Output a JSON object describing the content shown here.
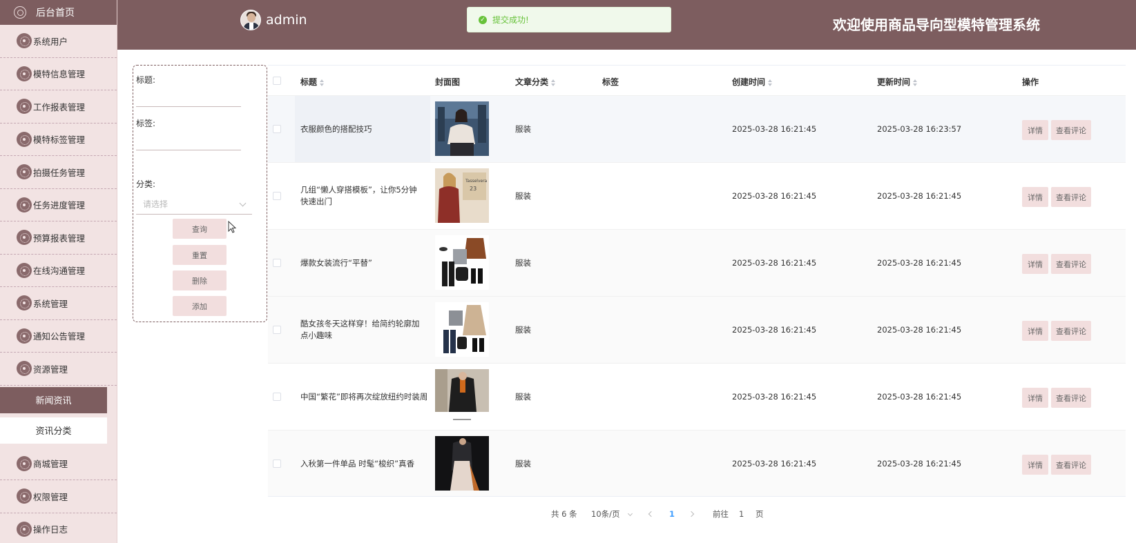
{
  "sidebar": {
    "home_label": "后台首页",
    "items": [
      {
        "label": "系统用户"
      },
      {
        "label": "模特信息管理"
      },
      {
        "label": "工作报表管理"
      },
      {
        "label": "模特标签管理"
      },
      {
        "label": "拍摄任务管理"
      },
      {
        "label": "任务进度管理"
      },
      {
        "label": "预算报表管理"
      },
      {
        "label": "在线沟通管理"
      },
      {
        "label": "系统管理"
      },
      {
        "label": "通知公告管理"
      },
      {
        "label": "资源管理"
      }
    ],
    "submenu_active": "新闻资讯",
    "submenu_item": "资讯分类",
    "items_after": [
      {
        "label": "商城管理"
      },
      {
        "label": "权限管理"
      },
      {
        "label": "操作日志"
      }
    ]
  },
  "header": {
    "username": "admin",
    "toast_message": "提交成功!",
    "system_title": "欢迎使用商品导向型模特管理系统"
  },
  "search": {
    "title_label": "标题:",
    "tag_label": "标签:",
    "category_label": "分类:",
    "category_placeholder": "请选择",
    "query_button": "查询",
    "reset_button": "重置",
    "delete_button": "删除",
    "add_button": "添加"
  },
  "table": {
    "headers": {
      "title": "标题",
      "cover": "封面图",
      "category": "文章分类",
      "tag": "标签",
      "created": "创建时间",
      "updated": "更新时间",
      "ops": "操作"
    },
    "rows": [
      {
        "title": "衣服颜色的搭配技巧",
        "category": "服装",
        "tag": "",
        "created": "2025-03-28 16:21:45",
        "updated": "2025-03-28 16:23:57"
      },
      {
        "title": "几组“懒人穿搭模板”，让你5分钟快速出门",
        "category": "服装",
        "tag": "",
        "created": "2025-03-28 16:21:45",
        "updated": "2025-03-28 16:21:45"
      },
      {
        "title": "爆款女装流行“平替”",
        "category": "服装",
        "tag": "",
        "created": "2025-03-28 16:21:45",
        "updated": "2025-03-28 16:21:45"
      },
      {
        "title": "酷女孩冬天这样穿！给简约轮廓加点小趣味",
        "category": "服装",
        "tag": "",
        "created": "2025-03-28 16:21:45",
        "updated": "2025-03-28 16:21:45"
      },
      {
        "title": "中国“繁花”即将再次绽放纽约时装周",
        "category": "服装",
        "tag": "",
        "created": "2025-03-28 16:21:45",
        "updated": "2025-03-28 16:21:45"
      },
      {
        "title": "入秋第一件单品 时髦“梭织”真香",
        "category": "服装",
        "tag": "",
        "created": "2025-03-28 16:21:45",
        "updated": "2025-03-28 16:21:45"
      }
    ],
    "detail_button": "详情",
    "comments_button": "查看评论"
  },
  "pagination": {
    "total": "共 6 条",
    "page_size": "10条/页",
    "current_page": "1",
    "goto_prefix": "前往",
    "goto_value": "1",
    "goto_suffix": "页"
  },
  "colors": {
    "brand": "#7d5d5f",
    "sidebar_bg": "#f2e3e3",
    "button_bg": "#f2dede",
    "success": "#67c23a"
  }
}
